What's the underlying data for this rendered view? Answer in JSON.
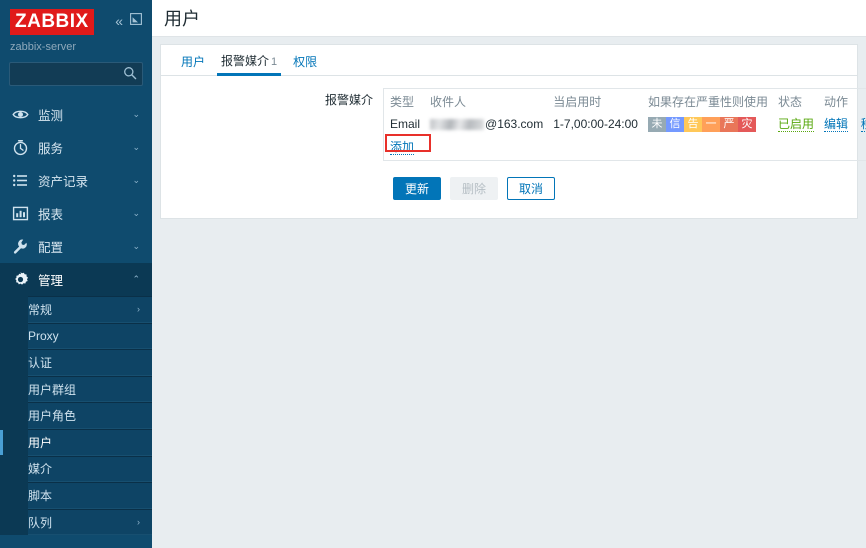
{
  "sidebar": {
    "logo": "ZABBIX",
    "server_name": "zabbix-server",
    "collapse_icon": "double-chevron-left-icon",
    "fullscreen_icon": "expand-box-icon",
    "search": {
      "value": "",
      "placeholder": ""
    },
    "nav": [
      {
        "label": "监测",
        "icon": "eye-icon",
        "chevron": "⌄",
        "active": false
      },
      {
        "label": "服务",
        "icon": "stopwatch-icon",
        "chevron": "⌄",
        "active": false
      },
      {
        "label": "资产记录",
        "icon": "list-icon",
        "chevron": "⌄",
        "active": false
      },
      {
        "label": "报表",
        "icon": "bar-chart-icon",
        "chevron": "⌄",
        "active": false
      },
      {
        "label": "配置",
        "icon": "wrench-icon",
        "chevron": "⌄",
        "active": false
      },
      {
        "label": "管理",
        "icon": "gear-icon",
        "chevron": "⌃",
        "active": true
      }
    ],
    "submenu": [
      {
        "label": "常规",
        "chevron": "›",
        "selected": false
      },
      {
        "label": "Proxy",
        "chevron": "",
        "selected": false
      },
      {
        "label": "认证",
        "chevron": "",
        "selected": false
      },
      {
        "label": "用户群组",
        "chevron": "",
        "selected": false
      },
      {
        "label": "用户角色",
        "chevron": "",
        "selected": false
      },
      {
        "label": "用户",
        "chevron": "",
        "selected": true
      },
      {
        "label": "媒介",
        "chevron": "",
        "selected": false
      },
      {
        "label": "脚本",
        "chevron": "",
        "selected": false
      },
      {
        "label": "队列",
        "chevron": "›",
        "selected": false
      }
    ]
  },
  "header": {
    "title": "用户"
  },
  "tabs": [
    {
      "label": "用户",
      "count": "",
      "active": false
    },
    {
      "label": "报警媒介",
      "count": "1",
      "active": true
    },
    {
      "label": "权限",
      "count": "",
      "active": false
    }
  ],
  "form": {
    "media_label": "报警媒介",
    "columns": [
      "类型",
      "收件人",
      "当启用时",
      "如果存在严重性则使用",
      "状态",
      "动作"
    ],
    "rows": [
      {
        "type": "Email",
        "recipient_redacted": true,
        "recipient_suffix": "@163.com",
        "when_active": "1-7,00:00-24:00",
        "severities": [
          {
            "label": "未",
            "color": "#97aab3"
          },
          {
            "label": "信",
            "color": "#7499ff"
          },
          {
            "label": "告",
            "color": "#ffc859"
          },
          {
            "label": "一",
            "color": "#ffa059"
          },
          {
            "label": "严",
            "color": "#e97659"
          },
          {
            "label": "灾",
            "color": "#e45959"
          }
        ],
        "status": "已启用",
        "actions": [
          "编辑",
          "移除"
        ]
      }
    ],
    "add_link": "添加",
    "buttons": [
      {
        "label": "更新",
        "style": "primary"
      },
      {
        "label": "删除",
        "style": "disabled"
      },
      {
        "label": "取消",
        "style": "ghost"
      }
    ]
  },
  "colors": {
    "brand_red": "#e01a1a",
    "sidebar_bg": "#0f4b6e",
    "link_blue": "#0275b8",
    "status_green": "#59a80f",
    "annotation_red": "#e8302a"
  }
}
